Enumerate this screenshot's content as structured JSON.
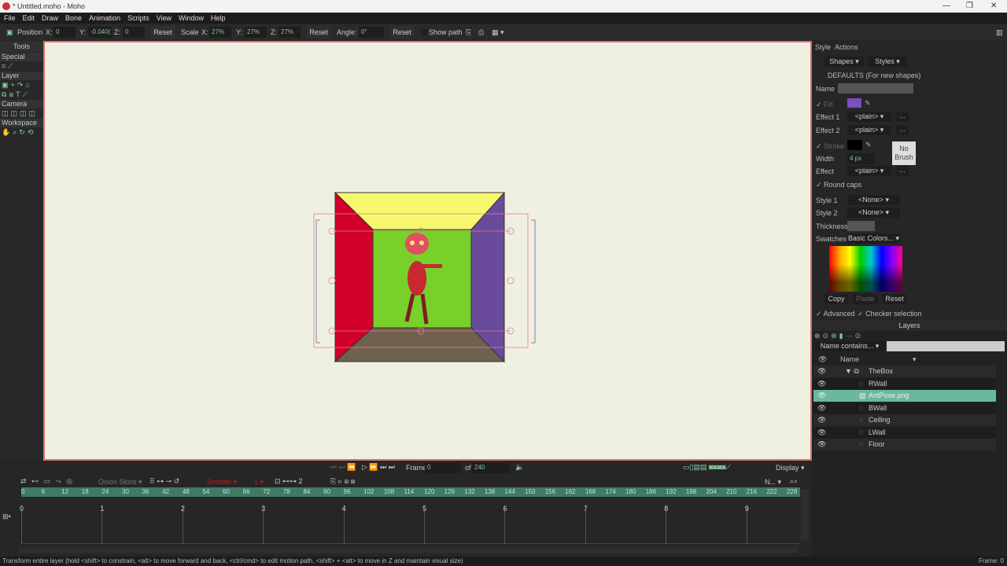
{
  "window": {
    "title": "* Untitled.moho - Moho",
    "minimize": "—",
    "maximize": "❐",
    "close": "✕"
  },
  "menu": [
    "File",
    "Edit",
    "Draw",
    "Bone",
    "Animation",
    "Scripts",
    "View",
    "Window",
    "Help"
  ],
  "toolbar": {
    "position_label": "Position",
    "x_label": "X:",
    "x": "0",
    "y_label": "Y:",
    "y": "-0.040(",
    "z_label": "Z:",
    "z": "0",
    "reset1": "Reset",
    "scale_label": "Scale",
    "sx_label": "X:",
    "sx": "27%",
    "sy_label": "Y:",
    "sy": "27%",
    "sz_label": "Z:",
    "sz": "27%",
    "reset2": "Reset",
    "angle_label": "Angle:",
    "angle": "0°",
    "reset3": "Reset",
    "show_path": "Show path"
  },
  "tools": {
    "title": "Tools",
    "sections": [
      {
        "label": "Special",
        "icons": [
          "⌗",
          "⟋"
        ]
      },
      {
        "label": "Layer",
        "icons": [
          "▣",
          "+",
          "↷",
          "⌂"
        ]
      },
      {
        "label": "",
        "icons": [
          "⧉",
          "⧈",
          "T",
          "⟋"
        ]
      },
      {
        "label": "Camera",
        "icons": [
          "◫",
          "◫",
          "◫",
          "◫"
        ]
      },
      {
        "label": "Workspace",
        "icons": [
          "✋",
          "⌕",
          "↻",
          "⟲"
        ]
      }
    ]
  },
  "style_panel": {
    "tabs": [
      "Style",
      "Actions"
    ],
    "shapes": "Shapes",
    "styles": "Styles",
    "defaults": "DEFAULTS (For new shapes)",
    "name_label": "Name",
    "fill_label": "Fill",
    "fill_color": "#7a4fbf",
    "effect1_label": "Effect 1",
    "effect1": "<plain>",
    "effect2_label": "Effect 2",
    "effect2": "<plain>",
    "stroke_label": "Stroke",
    "stroke_color": "#000000",
    "width_label": "Width",
    "width": "4 px",
    "no_brush": "No Brush",
    "effect_label": "Effect",
    "effect": "<plain>",
    "more": "...",
    "round_caps": "Round caps",
    "style1_label": "Style 1",
    "style1": "<None>",
    "style2_label": "Style 2",
    "style2": "<None>",
    "thickness_label": "Thickness",
    "swatches_label": "Swatches",
    "swatches": "Basic Colors...",
    "copy": "Copy",
    "paste": "Paste",
    "reset": "Reset",
    "advanced": "Advanced",
    "checker": "Checker selection"
  },
  "layers": {
    "title": "Layers",
    "filter": "Name contains...",
    "name_header": "Name",
    "items": [
      {
        "name": "TheBox",
        "type": "group",
        "selected": false
      },
      {
        "name": "RWall",
        "type": "vector",
        "selected": false
      },
      {
        "name": "AntPose.png",
        "type": "image",
        "selected": true
      },
      {
        "name": "BWall",
        "type": "vector",
        "selected": false
      },
      {
        "name": "Ceiling",
        "type": "vector",
        "selected": false
      },
      {
        "name": "LWall",
        "type": "vector",
        "selected": false
      },
      {
        "name": "Floor",
        "type": "vector",
        "selected": false
      }
    ]
  },
  "playback": {
    "frame_label": "Frame",
    "frame": "0",
    "of_label": "of",
    "total": "240",
    "display": "Display"
  },
  "timeline": {
    "onion_skins": "Onion Skins",
    "interp": "Smooth",
    "interp_num": "1",
    "keys_num": "2",
    "zoom_select": "N...",
    "ruler_start": 0,
    "ruler_step": 6,
    "ruler_end": 228,
    "seconds": [
      1,
      2,
      3,
      4,
      5,
      6,
      7,
      8,
      9
    ]
  },
  "status": {
    "text": "Transform entire layer (hold <shift> to constrain, <alt> to move forward and back, <ctrl/cmd> to edit motion path, <shift> + <alt> to move in Z and maintain visual size)",
    "frame": "Frame: 0"
  },
  "colors": {
    "accent": "#5fae94",
    "selection": "#6ab8a0",
    "ceiling": "#f8f870",
    "lwall": "#d0002a",
    "rwall": "#6a4a9a",
    "back": "#78d02a",
    "floor": "#706050"
  }
}
